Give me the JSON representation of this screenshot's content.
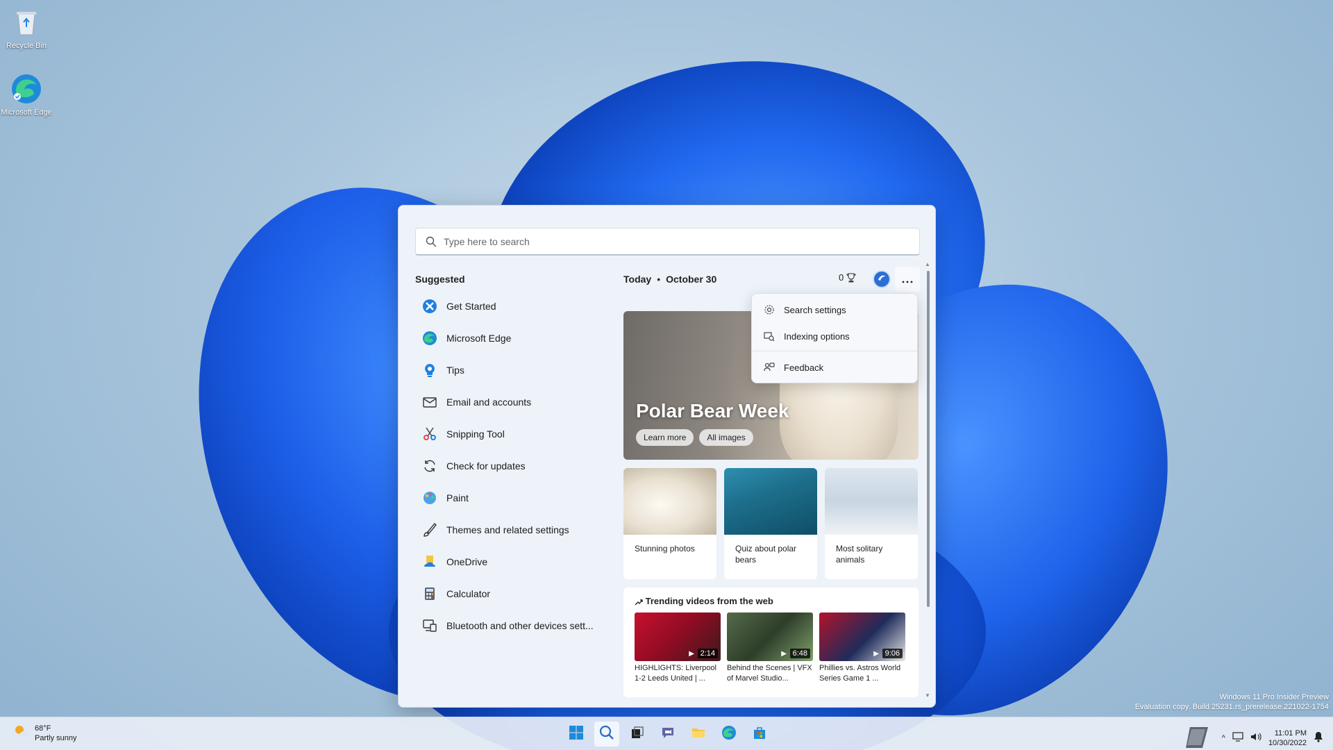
{
  "desktop": {
    "icons": [
      {
        "label": "Recycle Bin",
        "icon": "recycle-bin-icon"
      },
      {
        "label": "Microsoft Edge",
        "icon": "edge-icon"
      }
    ]
  },
  "search": {
    "placeholder": "Type here to search",
    "value": ""
  },
  "suggested": {
    "title": "Suggested",
    "items": [
      {
        "label": "Get Started",
        "icon": "get-started-icon"
      },
      {
        "label": "Microsoft Edge",
        "icon": "edge-icon"
      },
      {
        "label": "Tips",
        "icon": "tips-icon"
      },
      {
        "label": "Email and accounts",
        "icon": "mail-icon"
      },
      {
        "label": "Snipping Tool",
        "icon": "snipping-tool-icon"
      },
      {
        "label": "Check for updates",
        "icon": "refresh-icon"
      },
      {
        "label": "Paint",
        "icon": "paint-icon"
      },
      {
        "label": "Themes and related settings",
        "icon": "brush-icon"
      },
      {
        "label": "OneDrive",
        "icon": "onedrive-icon"
      },
      {
        "label": "Calculator",
        "icon": "calculator-icon"
      },
      {
        "label": "Bluetooth and other devices sett...",
        "icon": "devices-icon"
      }
    ]
  },
  "highlights": {
    "today": "Today",
    "date": "October 30",
    "points": "0",
    "hero": {
      "title": "Polar Bear Week",
      "learn_more": "Learn more",
      "all_images": "All images"
    },
    "cards": [
      {
        "label": "Stunning photos"
      },
      {
        "label": "Quiz about polar bears"
      },
      {
        "label": "Most solitary animals"
      }
    ],
    "trending": {
      "title": "Trending videos from the web",
      "videos": [
        {
          "label": "HIGHLIGHTS: Liverpool 1-2 Leeds United | ...",
          "duration": "2:14"
        },
        {
          "label": "Behind the Scenes | VFX of Marvel Studio...",
          "duration": "6:48"
        },
        {
          "label": "Phillies vs. Astros World Series Game 1 ...",
          "duration": "9:06"
        }
      ]
    }
  },
  "menu": {
    "items": [
      {
        "label": "Search settings",
        "icon": "gear-icon"
      },
      {
        "label": "Indexing options",
        "icon": "indexing-icon"
      },
      {
        "label": "Feedback",
        "icon": "feedback-icon"
      }
    ]
  },
  "watermark": {
    "line1": "Windows 11 Pro Insider Preview",
    "line2": "Evaluation copy. Build 25231.rs_prerelease.221022-1754"
  },
  "taskbar": {
    "weather_temp": "68°F",
    "weather_desc": "Partly sunny",
    "time": "11:01 PM",
    "date": "10/30/2022"
  },
  "colors": {
    "accent": "#0067c0",
    "panel_bg": "#eef3fa"
  }
}
